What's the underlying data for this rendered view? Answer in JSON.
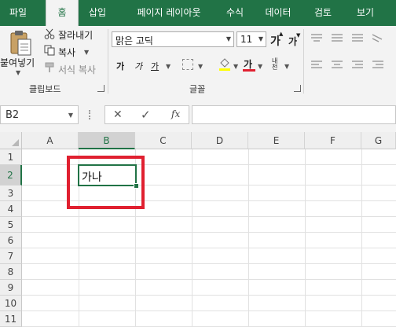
{
  "tabs": [
    "파일",
    "홈",
    "삽입",
    "페이지 레이아웃",
    "수식",
    "데이터",
    "검토",
    "보기"
  ],
  "ribbon": {
    "clipboard": {
      "paste": "붙여넣기",
      "cut": "잘라내기",
      "copy": "복사",
      "format_painter": "서식 복사",
      "group_label": "클립보드"
    },
    "font": {
      "name": "맑은 고딕",
      "size": "11",
      "grow": "가",
      "shrink": "가",
      "bold": "가",
      "italic": "가",
      "underline": "가",
      "font_color_letter": "가",
      "phonetic": "내천",
      "group_label": "글꼴"
    }
  },
  "formula_bar": {
    "name_box": "B2",
    "cancel": "✕",
    "enter": "✓",
    "fx": "fx",
    "content": ""
  },
  "grid": {
    "columns": [
      "A",
      "B",
      "C",
      "D",
      "E",
      "F",
      "G"
    ],
    "rows": [
      "1",
      "2",
      "3",
      "4",
      "5",
      "6",
      "7",
      "8",
      "9",
      "10",
      "11"
    ],
    "selected_cell": "B2",
    "cell_b2": "가나"
  },
  "colors": {
    "accent": "#217346",
    "highlight": "#e02030"
  }
}
